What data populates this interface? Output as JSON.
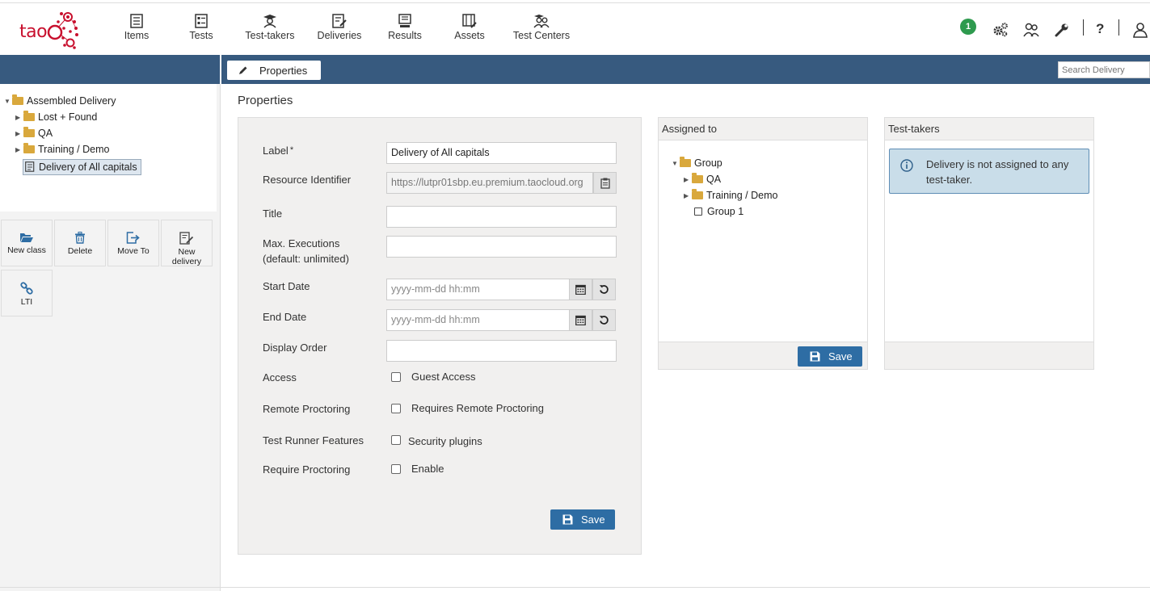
{
  "logo": {
    "text": "tao"
  },
  "nav": {
    "items": [
      {
        "label": "Items",
        "icon": "items-icon"
      },
      {
        "label": "Tests",
        "icon": "tests-icon"
      },
      {
        "label": "Test-takers",
        "icon": "test-takers-icon"
      },
      {
        "label": "Deliveries",
        "icon": "deliveries-icon"
      },
      {
        "label": "Results",
        "icon": "results-icon"
      },
      {
        "label": "Assets",
        "icon": "assets-icon"
      },
      {
        "label": "Test Centers",
        "icon": "test-centers-icon"
      }
    ]
  },
  "header_right": {
    "notification_count": "1",
    "help_label": "?"
  },
  "toolbar": {
    "tab_label": "Properties",
    "search_placeholder": "Search Delivery"
  },
  "tree": {
    "root": "Assembled Delivery",
    "children": [
      "Lost + Found",
      "QA",
      "Training / Demo"
    ],
    "selected": "Delivery of All capitals"
  },
  "actions": {
    "new_class": "New class",
    "delete": "Delete",
    "move_to": "Move To",
    "new_delivery_1": "New",
    "new_delivery_2": "delivery",
    "lti": "LTI"
  },
  "main": {
    "title": "Properties",
    "form": {
      "label_label": "Label",
      "label_required": "*",
      "label_value": "Delivery of All capitals",
      "resource_id_label": "Resource Identifier",
      "resource_id_value": "https://lutpr01sbp.eu.premium.taocloud.org",
      "title_label": "Title",
      "title_value": "",
      "max_exec_label_1": "Max. Executions",
      "max_exec_label_2": "(default: unlimited)",
      "max_exec_value": "",
      "start_date_label": "Start Date",
      "end_date_label": "End Date",
      "date_placeholder": "yyyy-mm-dd hh:mm",
      "display_order_label": "Display Order",
      "display_order_value": "",
      "access_label": "Access",
      "access_option": "Guest Access",
      "remote_label": "Remote Proctoring",
      "remote_option": "Requires Remote Proctoring",
      "runner_label": "Test Runner Features",
      "runner_option": "Security plugins",
      "require_label": "Require Proctoring",
      "require_option": "Enable",
      "save_label": "Save"
    }
  },
  "assigned": {
    "title": "Assigned to",
    "root": "Group",
    "children": [
      "QA",
      "Training / Demo"
    ],
    "item": "Group 1",
    "save_label": "Save"
  },
  "testtakers": {
    "title": "Test-takers",
    "message": "Delivery is not assigned to any test-taker."
  },
  "colors": {
    "brand": "#c8102e",
    "bar": "#375a7f",
    "button": "#2e6da4",
    "badge": "#2e9a4e",
    "folder": "#d9a83c"
  }
}
